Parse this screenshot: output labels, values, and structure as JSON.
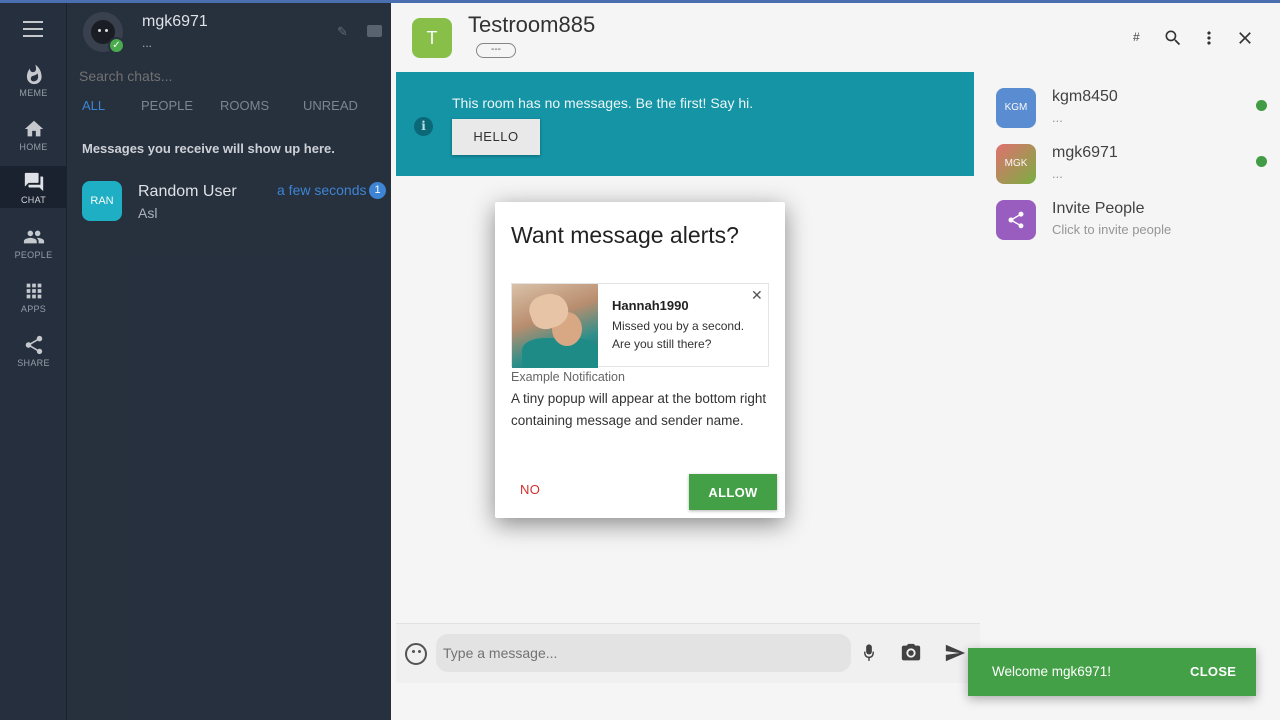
{
  "rail": {
    "items": [
      {
        "label": "MEME",
        "icon": "flame-icon"
      },
      {
        "label": "HOME",
        "icon": "home-icon"
      },
      {
        "label": "CHAT",
        "icon": "chat-icon"
      },
      {
        "label": "PEOPLE",
        "icon": "people-icon"
      },
      {
        "label": "APPS",
        "icon": "apps-icon"
      },
      {
        "label": "SHARE",
        "icon": "share-icon"
      }
    ]
  },
  "sidebar": {
    "user_name": "mgk6971",
    "user_status": "...",
    "search_placeholder": "Search chats...",
    "tabs": [
      "ALL",
      "PEOPLE",
      "ROOMS",
      "UNREAD"
    ],
    "hint": "Messages you receive will show up here.",
    "chats": [
      {
        "avatar": "RAN",
        "name": "Random User",
        "last": "Asl",
        "time": "a few seconds",
        "unread": "1"
      }
    ]
  },
  "room": {
    "avatar": "T",
    "title": "Testroom885",
    "chip": "---",
    "hash": "#"
  },
  "banner": {
    "text": "This room has no messages. Be the first! Say hi.",
    "hello": "HELLO"
  },
  "members": [
    {
      "avatar": "KGM",
      "name": "kgm8450",
      "sub": "...",
      "color": "#5c8fd6",
      "online": true
    },
    {
      "avatar": "MGK",
      "name": "mgk6971",
      "sub": "...",
      "color": "#6a9e4a",
      "online": true
    },
    {
      "avatar": "",
      "name": "Invite People",
      "sub": "Click to invite people",
      "color": "#9c5fc2",
      "online": false
    }
  ],
  "composer": {
    "placeholder": "Type a message..."
  },
  "dialog": {
    "title": "Want message alerts?",
    "notif_name": "Hannah1990",
    "notif_text": "Missed you by a second. Are you still there?",
    "example_label": "Example Notification",
    "description": "A tiny popup will appear at the bottom right containing message and sender name.",
    "no": "NO",
    "allow": "ALLOW"
  },
  "snackbar": {
    "text": "Welcome mgk6971!",
    "close": "CLOSE"
  },
  "colors": {
    "accent_blue": "#3f88d9",
    "banner": "#1597a9",
    "success": "#43a047",
    "danger": "#d32f2f"
  }
}
